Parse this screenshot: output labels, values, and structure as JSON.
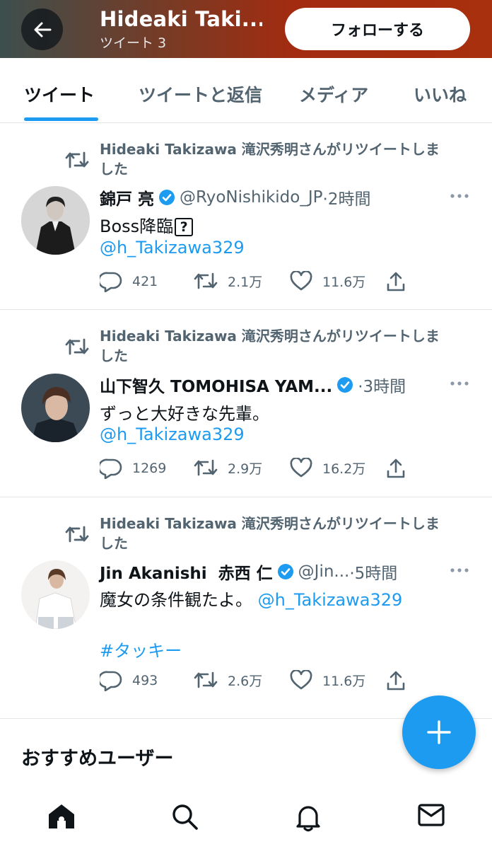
{
  "header": {
    "title": "Hideaki Taki...",
    "subtitle": "ツイート 3",
    "follow_label": "フォローする"
  },
  "tabs": [
    {
      "label": "ツイート",
      "active": true
    },
    {
      "label": "ツイートと返信",
      "active": false
    },
    {
      "label": "メディア",
      "active": false
    },
    {
      "label": "いいね",
      "active": false
    }
  ],
  "tweets": [
    {
      "retweet_line1": "Hideaki Takizawa 滝沢秀明さんがリツイートしま",
      "retweet_line2": "した",
      "name": "錦戸 亮",
      "handle": "@RyoNishikido_JP",
      "time": "·2時間",
      "text": "Boss降臨",
      "text_symbol": "?",
      "mention": "@h_Takizawa329",
      "replies": "421",
      "retweets": "2.1万",
      "likes": "11.6万"
    },
    {
      "retweet_line1": "Hideaki Takizawa 滝沢秀明さんがリツイートしま",
      "retweet_line2": "した",
      "name": "山下智久 TOMOHISA YAM...",
      "handle": "",
      "time": "·3時間",
      "text": "ずっと大好きな先輩。",
      "mention": "@h_Takizawa329",
      "replies": "1269",
      "retweets": "2.9万",
      "likes": "16.2万"
    },
    {
      "retweet_line1": "Hideaki Takizawa 滝沢秀明さんがリツイートしま",
      "retweet_line2": "した",
      "name": "Jin Akanishi  赤西 仁",
      "handle": "@Jin...",
      "time": "·5時間",
      "text": "魔女の条件観たよ。",
      "mention": "@h_Takizawa329",
      "hashtag": "#タッキー",
      "replies": "493",
      "retweets": "2.6万",
      "likes": "11.6万"
    }
  ],
  "recommend_title": "おすすめユーザー",
  "nav": [
    "home-icon",
    "search-icon",
    "bell-icon",
    "mail-icon"
  ],
  "colors": {
    "accent": "#1d9bf0",
    "muted": "#536471",
    "text": "#0f1419"
  }
}
